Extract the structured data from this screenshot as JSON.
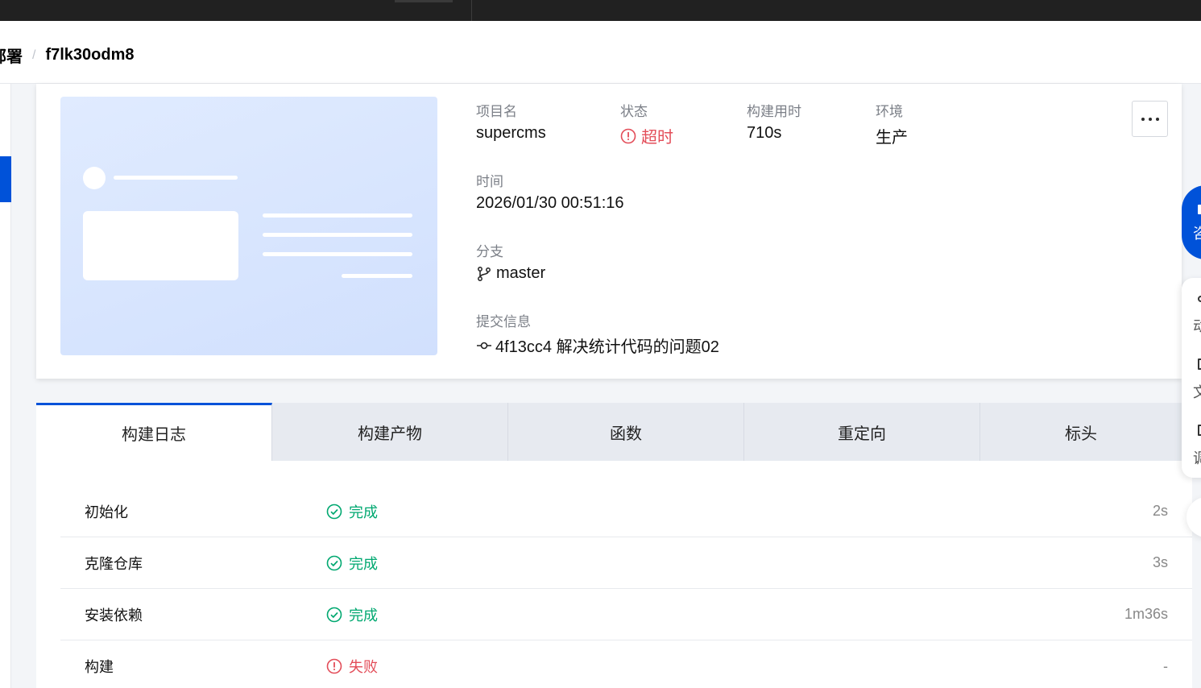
{
  "breadcrumb": {
    "parent": "部署",
    "separator": "/",
    "current": "f7lk30odm8"
  },
  "info": {
    "project_label": "项目名",
    "project_value": "supercms",
    "status_label": "状态",
    "status_value": "超时",
    "duration_label": "构建用时",
    "duration_value": "710s",
    "env_label": "环境",
    "env_value": "生产",
    "time_label": "时间",
    "time_value": "2026/01/30 00:51:16",
    "branch_label": "分支",
    "branch_value": "master",
    "commit_label": "提交信息",
    "commit_value": "4f13cc4 解决统计代码的问题02"
  },
  "tabs": [
    {
      "label": "构建日志",
      "active": true
    },
    {
      "label": "构建产物",
      "active": false
    },
    {
      "label": "函数",
      "active": false
    },
    {
      "label": "重定向",
      "active": false
    },
    {
      "label": "标头",
      "active": false
    }
  ],
  "logs": [
    {
      "step": "初始化",
      "state": "完成",
      "status": "success",
      "duration": "2s"
    },
    {
      "step": "克隆仓库",
      "state": "完成",
      "status": "success",
      "duration": "3s"
    },
    {
      "step": "安装依赖",
      "state": "完成",
      "status": "success",
      "duration": "1m36s"
    },
    {
      "step": "构建",
      "state": "失败",
      "status": "error",
      "duration": "-"
    }
  ],
  "floating": {
    "consult_text": "咨",
    "items": [
      "动",
      "文",
      "调"
    ]
  },
  "colors": {
    "brand": "#0052d9",
    "success": "#00a870",
    "error": "#e34d59"
  },
  "icons": {
    "status_timeout": "error-circle-icon",
    "branch": "git-branch-icon",
    "commit": "git-commit-icon",
    "more": "more-horizontal-icon",
    "log_success": "check-circle-icon",
    "log_error": "error-circle-icon"
  }
}
